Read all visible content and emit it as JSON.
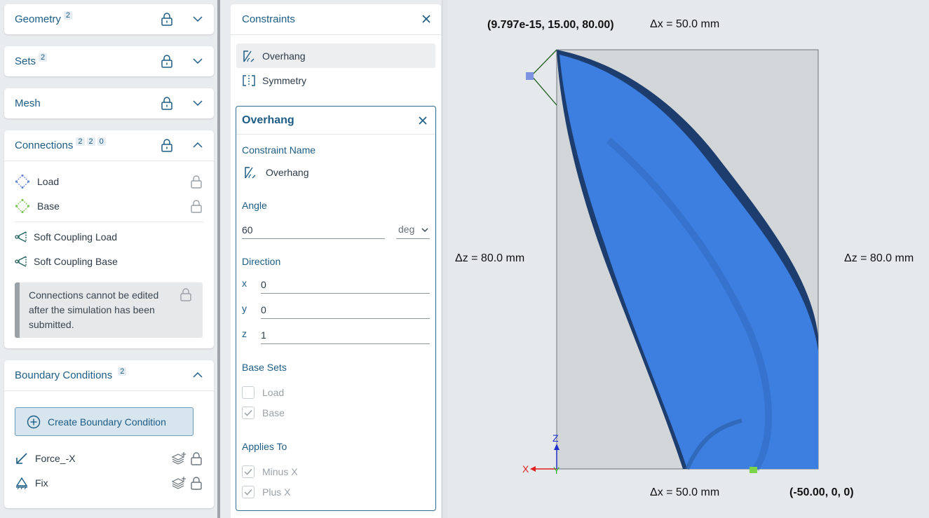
{
  "left": {
    "geometry": {
      "title": "Geometry",
      "count": "2"
    },
    "sets": {
      "title": "Sets",
      "count": "2"
    },
    "mesh": {
      "title": "Mesh"
    },
    "connections": {
      "title": "Connections",
      "counts": [
        "2",
        "2",
        "0"
      ],
      "items": [
        {
          "label": "Load",
          "icon": "load-connector-icon"
        },
        {
          "label": "Base",
          "icon": "base-connector-icon"
        },
        {
          "label": "Soft Coupling Load",
          "icon": "soft-coupling-icon"
        },
        {
          "label": "Soft Coupling Base",
          "icon": "soft-coupling-icon"
        }
      ],
      "notice": "Connections cannot be edited after the simulation has been submitted."
    },
    "boundary": {
      "title": "Boundary Conditions",
      "count": "2",
      "create_label": "Create Boundary Condition",
      "items": [
        {
          "label": "Force_-X",
          "icon": "force-arrow-icon"
        },
        {
          "label": "Fix",
          "icon": "fixed-support-icon"
        }
      ]
    }
  },
  "constraints": {
    "title": "Constraints",
    "items": [
      {
        "label": "Overhang",
        "icon": "overhang-icon"
      },
      {
        "label": "Symmetry",
        "icon": "symmetry-icon"
      }
    ],
    "editor": {
      "title": "Overhang",
      "name_label": "Constraint Name",
      "name_value": "Overhang",
      "angle_label": "Angle",
      "angle_value": "60",
      "angle_unit": "deg",
      "direction_label": "Direction",
      "dir": {
        "x_label": "x",
        "x": "0",
        "y_label": "y",
        "y": "0",
        "z_label": "z",
        "z": "1"
      },
      "base_sets_label": "Base Sets",
      "base_sets": [
        {
          "label": "Load",
          "checked": false
        },
        {
          "label": "Base",
          "checked": true
        }
      ],
      "applies_label": "Applies To",
      "applies": [
        {
          "label": "Minus X",
          "checked": true
        },
        {
          "label": "Plus X",
          "checked": true
        }
      ]
    }
  },
  "viewport": {
    "coord_top": "(9.797e-15, 15.00, 80.00)",
    "dx_top": "Δx = 50.0 mm",
    "dz_left": "Δz = 80.0 mm",
    "dz_right": "Δz = 80.0 mm",
    "dx_bottom": "Δx = 50.0 mm",
    "coord_bottom": "(-50.00, 0, 0)",
    "axis_x": "X",
    "axis_y": "Y",
    "axis_z": "Z",
    "colors": {
      "part": "#3d7fe0",
      "part_dark": "#1c3d6e",
      "box": "#d3d6d9",
      "axis_x": "#e02020",
      "axis_z": "#2030c8",
      "axis_y": "#30b030"
    }
  }
}
